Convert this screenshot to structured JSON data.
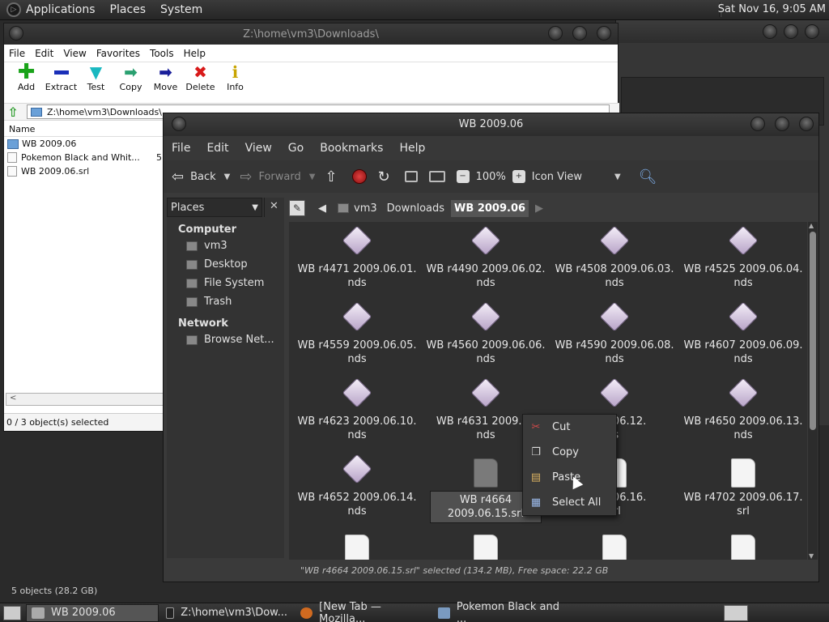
{
  "panel": {
    "menus": [
      "Applications",
      "Places",
      "System"
    ],
    "clock": "Sat Nov 16,  9:05 AM"
  },
  "zip": {
    "title": "Z:\\home\\vm3\\Downloads\\",
    "menus": [
      "File",
      "Edit",
      "View",
      "Favorites",
      "Tools",
      "Help"
    ],
    "toolbar": [
      {
        "label": "Add",
        "icon": "plus-icon",
        "color": "#1aa31a"
      },
      {
        "label": "Extract",
        "icon": "minus-icon",
        "color": "#1a2fb8"
      },
      {
        "label": "Test",
        "icon": "check-icon",
        "color": "#19b8c0"
      },
      {
        "label": "Copy",
        "icon": "copy-arrow-icon",
        "color": "#2aa070"
      },
      {
        "label": "Move",
        "icon": "move-arrow-icon",
        "color": "#1a1f9a"
      },
      {
        "label": "Delete",
        "icon": "x-icon",
        "color": "#d81a1a"
      },
      {
        "label": "Info",
        "icon": "info-icon",
        "color": "#c8a400"
      }
    ],
    "address": "Z:\\home\\vm3\\Downloads\\",
    "column_name": "Name",
    "files": [
      {
        "name": "WB 2009.06",
        "type": "folder",
        "size": ""
      },
      {
        "name": "Pokemon Black and Whit...",
        "type": "file",
        "size": "5"
      },
      {
        "name": "WB 2009.06.srl",
        "type": "file",
        "size": ""
      }
    ],
    "scroll_left": "<",
    "status": "0 / 3 object(s) selected"
  },
  "nautilus": {
    "title": "WB 2009.06",
    "menus": [
      "File",
      "Edit",
      "View",
      "Go",
      "Bookmarks",
      "Help"
    ],
    "toolbar": {
      "back": "Back",
      "forward": "Forward",
      "zoom": "100%",
      "view_mode": "Icon View"
    },
    "sidebar": {
      "selector": "Places",
      "groups": [
        {
          "title": "Computer",
          "items": [
            "vm3",
            "Desktop",
            "File System",
            "Trash"
          ]
        },
        {
          "title": "Network",
          "items": [
            "Browse Net..."
          ]
        }
      ]
    },
    "path": [
      "vm3",
      "Downloads",
      "WB 2009.06"
    ],
    "items": [
      {
        "name": "WB r4471 2009.06.01.nds",
        "l1": "WB r4471 2009.06.01.",
        "l2": "nds",
        "kind": "nds"
      },
      {
        "name": "WB r4490 2009.06.02.nds",
        "l1": "WB r4490 2009.06.02.",
        "l2": "nds",
        "kind": "nds"
      },
      {
        "name": "WB r4508 2009.06.03.nds",
        "l1": "WB r4508 2009.06.03.",
        "l2": "nds",
        "kind": "nds"
      },
      {
        "name": "WB r4525 2009.06.04.nds",
        "l1": "WB r4525 2009.06.04.",
        "l2": "nds",
        "kind": "nds"
      },
      {
        "name": "WB r4559 2009.06.05.nds",
        "l1": "WB r4559 2009.06.05.",
        "l2": "nds",
        "kind": "nds"
      },
      {
        "name": "WB r4560 2009.06.06.nds",
        "l1": "WB r4560 2009.06.06.",
        "l2": "nds",
        "kind": "nds"
      },
      {
        "name": "WB r4590 2009.06.08.nds",
        "l1": "WB r4590 2009.06.08.",
        "l2": "nds",
        "kind": "nds"
      },
      {
        "name": "WB r4607 2009.06.09.nds",
        "l1": "WB r4607 2009.06.09.",
        "l2": "nds",
        "kind": "nds"
      },
      {
        "name": "WB r4623 2009.06.10.nds",
        "l1": "WB r4623 2009.06.10.",
        "l2": "nds",
        "kind": "nds"
      },
      {
        "name": "WB r4631 2009.06",
        "l1": "WB r4631 2009.06",
        "l2": "nds",
        "kind": "nds"
      },
      {
        "name": "2009.06.12.",
        "l1": "2009.06.12.",
        "l2": "ls",
        "kind": "nds"
      },
      {
        "name": "WB r4650 2009.06.13.nds",
        "l1": "WB r4650 2009.06.13.",
        "l2": "nds",
        "kind": "nds"
      },
      {
        "name": "WB r4652 2009.06.14.nds",
        "l1": "WB r4652 2009.06.14.",
        "l2": "nds",
        "kind": "nds"
      },
      {
        "name": "WB r4664 2009.06.15.srl",
        "l1": "WB r4664",
        "l2": "2009.06.15.srl",
        "kind": "srl-selected"
      },
      {
        "name": "2009.06.16.srl",
        "l1": "2009.06.16.",
        "l2": "srl",
        "kind": "srl"
      },
      {
        "name": "WB r4702 2009.06.17.srl",
        "l1": "WB r4702 2009.06.17.",
        "l2": "srl",
        "kind": "srl"
      },
      {
        "name": "",
        "l1": "",
        "l2": "",
        "kind": "srl"
      },
      {
        "name": "",
        "l1": "",
        "l2": "",
        "kind": "srl"
      },
      {
        "name": "",
        "l1": "",
        "l2": "",
        "kind": "srl"
      },
      {
        "name": "",
        "l1": "",
        "l2": "",
        "kind": "srl"
      }
    ],
    "status": "\"WB r4664 2009.06.15.srl\" selected (134.2 MB), Free space: 22.2 GB"
  },
  "context_menu": {
    "items": [
      {
        "label": "Cut",
        "icon": "scissors-icon"
      },
      {
        "label": "Copy",
        "icon": "copy-icon"
      },
      {
        "label": "Paste",
        "icon": "paste-icon"
      },
      {
        "label": "Select All",
        "icon": "select-all-icon"
      }
    ]
  },
  "bg_status": "5 objects (28.2 GB)",
  "taskbar": {
    "tasks": [
      {
        "label": "WB 2009.06",
        "active": true
      },
      {
        "label": "Z:\\home\\vm3\\Dow...",
        "active": false
      },
      {
        "label": "[New Tab — Mozilla...",
        "active": false
      },
      {
        "label": "Pokemon Black and ...",
        "active": false
      }
    ]
  }
}
